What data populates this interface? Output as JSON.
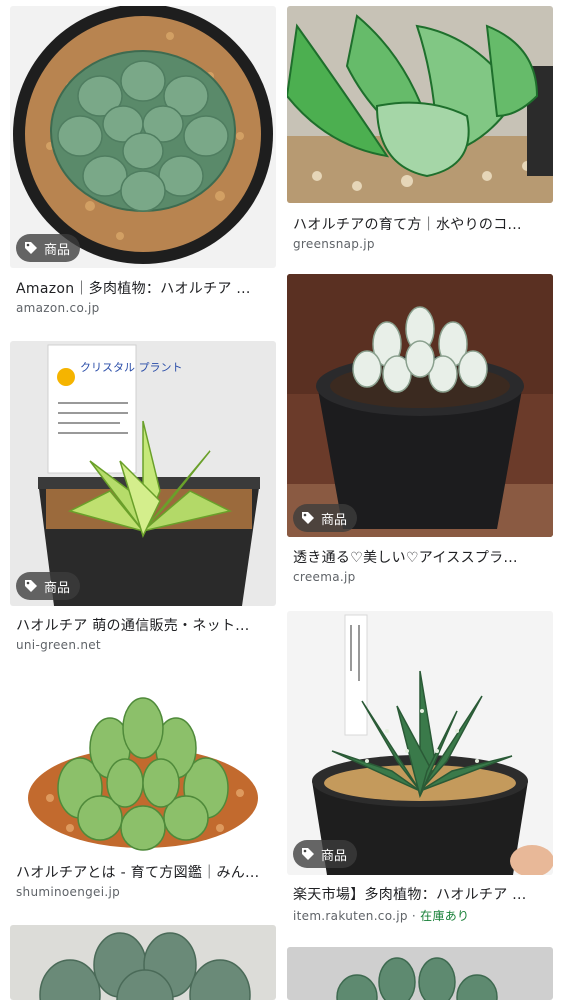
{
  "badge_label": "商品",
  "results": [
    {
      "title": "Amazon｜多肉植物：ハオルチア ...",
      "domain": "amazon.co.jp",
      "badge": true
    },
    {
      "title": "ハオルチアの育て方｜水やりのコ...",
      "domain": "greensnap.jp",
      "badge": false
    },
    {
      "title": "ハオルチア 萌の通信販売・ネット...",
      "domain": "uni-green.net",
      "badge": true
    },
    {
      "title": "透き通る♡美しい♡アイススプラ...",
      "domain": "creema.jp",
      "badge": true
    },
    {
      "title": "ハオルチアとは - 育て方図鑑｜みん...",
      "domain": "shuminoengei.jp",
      "badge": false
    },
    {
      "title": "楽天市場】多肉植物：ハオルチア ...",
      "domain": "item.rakuten.co.jp",
      "badge": true,
      "stock": "在庫あり"
    }
  ],
  "plant_tag_text": "クリスタル プラント"
}
